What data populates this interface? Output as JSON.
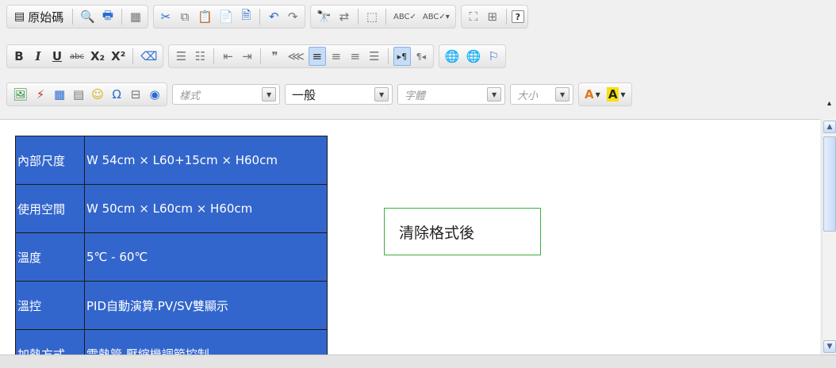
{
  "toolbar": {
    "row1": {
      "source_label": "原始碼",
      "icons": [
        "source-icon",
        "preview-icon",
        "print-icon",
        "templates-icon",
        "cut-icon",
        "copy-icon",
        "paste-icon",
        "paste-text-icon",
        "paste-word-icon",
        "undo-icon",
        "redo-icon",
        "find-icon",
        "replace-icon",
        "select-all-icon",
        "spellcheck-icon",
        "spellcheck-dropdown-icon",
        "maximize-icon",
        "show-blocks-icon",
        "help-icon"
      ]
    },
    "row2": {
      "bold": "B",
      "italic": "I",
      "underline": "U",
      "strike": "abc",
      "subscript": "X₂",
      "superscript": "X²"
    },
    "row3": {
      "styles_placeholder": "樣式",
      "format_value": "一般",
      "font_placeholder": "字體",
      "size_placeholder": "大小",
      "text_color_label": "A",
      "bg_color_label": "A"
    }
  },
  "content": {
    "table_rows": [
      {
        "key": "內部尺度",
        "value": "W 54cm × L60+15cm × H60cm"
      },
      {
        "key": "使用空間",
        "value": "W 50cm × L60cm × H60cm"
      },
      {
        "key": "溫度",
        "value": "5℃ - 60℃"
      },
      {
        "key": "溫控",
        "value": "PID自動演算.PV/SV雙顯示"
      },
      {
        "key": "加熱方式",
        "value": "電熱管.壓縮機調節控制"
      }
    ],
    "note": "清除格式後"
  },
  "colors": {
    "table_bg": "#3366cc",
    "note_border": "#3db03d",
    "active_button": "#c6dcf7"
  }
}
